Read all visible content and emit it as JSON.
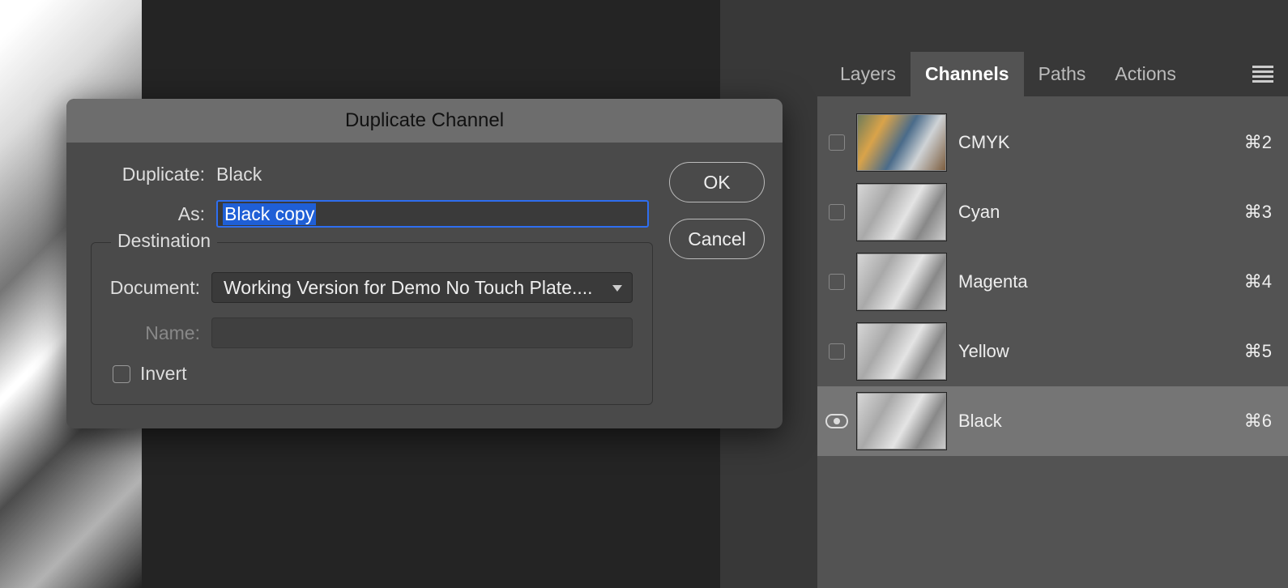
{
  "dialog": {
    "title": "Duplicate Channel",
    "duplicate_label": "Duplicate:",
    "duplicate_value": "Black",
    "as_label": "As:",
    "as_value": "Black copy",
    "destination_legend": "Destination",
    "document_label": "Document:",
    "document_value": "Working Version for Demo No Touch Plate....",
    "name_label": "Name:",
    "invert_label": "Invert",
    "ok_label": "OK",
    "cancel_label": "Cancel"
  },
  "panel": {
    "tabs": {
      "layers": "Layers",
      "channels": "Channels",
      "paths": "Paths",
      "actions": "Actions"
    },
    "channels": [
      {
        "name": "CMYK",
        "shortcut": "⌘2",
        "color": true,
        "visible": false,
        "selected": false
      },
      {
        "name": "Cyan",
        "shortcut": "⌘3",
        "color": false,
        "visible": false,
        "selected": false
      },
      {
        "name": "Magenta",
        "shortcut": "⌘4",
        "color": false,
        "visible": false,
        "selected": false
      },
      {
        "name": "Yellow",
        "shortcut": "⌘5",
        "color": false,
        "visible": false,
        "selected": false
      },
      {
        "name": "Black",
        "shortcut": "⌘6",
        "color": false,
        "visible": true,
        "selected": true
      }
    ]
  },
  "mini_panel_text": "—..."
}
